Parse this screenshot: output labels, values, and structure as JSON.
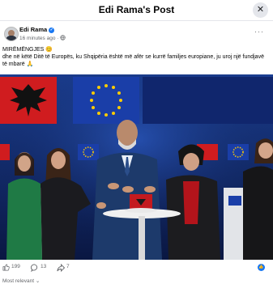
{
  "header": {
    "title": "Edi Rama's Post",
    "close_symbol": "✕"
  },
  "post": {
    "author": "Edi Rama",
    "verified_symbol": "✓",
    "time": "16 minutes ago",
    "privacy_separator": "·",
    "more_symbol": "···",
    "greeting": "MIRËMËNGJES 😊",
    "body": "dhe në këtë Ditë të Europës, ku Shqipëria është më afër se kurrë familjes europiane, ju uroj një fundjavë të mbarë 🙏"
  },
  "stats": {
    "likes": "199",
    "comments": "13",
    "shares": "7"
  },
  "comments": {
    "sort_label": "Most relevant ⌄"
  },
  "colors": {
    "facebook_blue": "#1877f2",
    "eu_blue": "#003399",
    "eu_gold": "#ffcc00",
    "albania_red": "#e41e20"
  }
}
